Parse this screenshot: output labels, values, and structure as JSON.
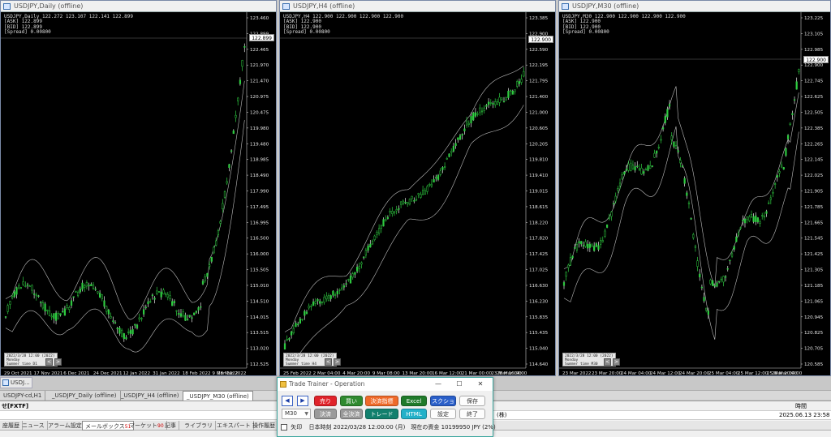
{
  "charts": [
    {
      "window_title": "USDJPY,Daily (offline)",
      "info": [
        "USDJPY,Daily 122.272 123.107 122.141 122.899",
        "[ASK] 122.899",
        "[BID] 122.899",
        "[Spread] 0.00800"
      ],
      "price_ticks": [
        "123.460",
        "122.899",
        "122.465",
        "121.970",
        "121.470",
        "120.975",
        "120.475",
        "119.980",
        "119.480",
        "118.985",
        "118.490",
        "117.990",
        "117.495",
        "116.995",
        "116.500",
        "116.000",
        "115.505",
        "115.010",
        "114.510",
        "114.015",
        "113.515",
        "113.020",
        "112.525"
      ],
      "date_ticks": [
        "29 Oct 2021",
        "17 Nov 2021",
        "6 Dec 2021",
        "24 Dec 2021",
        "12 Jan 2022",
        "31 Jan 2022",
        "18 Feb 2022",
        "9 Mar 2022",
        "28 Mar 2022"
      ],
      "current_price": "122.899",
      "mini_info": [
        "2022/3/28 12:00 (2022)",
        "Monday",
        "Summer time  D1"
      ],
      "mini_buttons": [
        "<",
        ">"
      ]
    },
    {
      "window_title": "USDJPY,H4 (offline)",
      "info": [
        "USDJPY,H4 122.900 122.900 122.900 122.900",
        "[ASK] 122.900",
        "[BID] 122.900",
        "[Spread] 0.00800"
      ],
      "price_ticks": [
        "123.385",
        "122.900",
        "122.590",
        "122.195",
        "121.795",
        "121.400",
        "121.000",
        "120.605",
        "120.205",
        "119.810",
        "119.410",
        "119.015",
        "118.615",
        "118.220",
        "117.820",
        "117.425",
        "117.025",
        "116.630",
        "116.230",
        "115.835",
        "115.435",
        "115.040",
        "114.640"
      ],
      "date_ticks": [
        "25 Feb 2022",
        "2 Mar 04:00",
        "4 Mar 20:00",
        "9 Mar 08:00",
        "13 Mar 20:00",
        "16 Mar 12:00",
        "21 Mar 00:00",
        "23 Mar 16:00",
        "28 Mar 04:00"
      ],
      "current_price": "122.900",
      "mini_info": [
        "2022/3/28 12:00 (2022)",
        "Monday",
        "Summer time  H4"
      ],
      "mini_buttons": [
        "<",
        ">"
      ]
    },
    {
      "window_title": "USDJPY,M30 (offline)",
      "info": [
        "USDJPY,M30 122.900 122.900 122.900 122.900",
        "[ASK] 122.900",
        "[BID] 122.900",
        "[Spread] 0.00800"
      ],
      "price_ticks": [
        "123.225",
        "123.105",
        "122.985",
        "122.900",
        "122.745",
        "122.625",
        "122.505",
        "122.385",
        "122.265",
        "122.145",
        "122.025",
        "121.905",
        "121.785",
        "121.665",
        "121.545",
        "121.425",
        "121.305",
        "121.185",
        "121.065",
        "120.945",
        "120.825",
        "120.705",
        "120.585"
      ],
      "date_ticks": [
        "23 Mar 2022",
        "23 Mar 20:00",
        "24 Mar 04:00",
        "24 Mar 12:00",
        "24 Mar 20:00",
        "25 Mar 04:00",
        "25 Mar 12:00",
        "25 Mar 20:00",
        "28 Mar 04:00"
      ],
      "current_price": "122.900",
      "mini_info": [
        "2022/3/28 12:00 (2022)",
        "Monday",
        "Summer time  M30"
      ],
      "mini_buttons": [
        "<",
        ">"
      ]
    }
  ],
  "mini_window_label": "USDJ...",
  "chart_tabs": [
    "USDJPY-cd,H1",
    "_USDJPY_Daily (offline)",
    "_USDJPY_H4 (offline)",
    "_USDJPY_M30 (offline)"
  ],
  "terminal": {
    "header_left": "せ[FXTF]",
    "header_right": "時間",
    "row_right_label": "(株)",
    "timestamp": "2025.06.13 23:58",
    "tabs": [
      {
        "label": "座履歴",
        "count": ""
      },
      {
        "label": "ニュース",
        "count": ""
      },
      {
        "label": "アラーム設定",
        "count": ""
      },
      {
        "label": "メールボックス",
        "count": "51"
      },
      {
        "label": "マーケット",
        "count": "90"
      },
      {
        "label": "記事",
        "count": ""
      },
      {
        "label": "ライブラリ",
        "count": ""
      },
      {
        "label": "エキスパート",
        "count": ""
      },
      {
        "label": "操作履歴",
        "count": ""
      }
    ]
  },
  "dialog": {
    "title": "Trade Trainer - Operation",
    "controls": {
      "minimize": "—",
      "maximize": "☐",
      "close": "✕"
    },
    "nav_prev": "◀",
    "nav_next": "▶",
    "timeframe": "M30",
    "buttons": {
      "sell": "売り",
      "buy": "買い",
      "close_order": "決済指標",
      "excel": "Excel",
      "screenshot": "スクショ",
      "save": "保存",
      "settle": "決済",
      "settle_all": "全決済",
      "trade": "トレード",
      "html": "HTML",
      "settings": "設定",
      "exit": "終了"
    },
    "colors": {
      "sell": "#e0232a",
      "buy": "#2f8a2f",
      "close_order": "#ef6a2a",
      "excel": "#1f7a2a",
      "screenshot": "#2a5fc9",
      "settle": "#9a9a9a",
      "trade": "#12806e",
      "html": "#23b1c9"
    },
    "arrow_label": "矢印",
    "status_text": "日本時刻 2022/03/28 12:00:00 (月)　現在の資金 10199950 JPY (2%)"
  }
}
